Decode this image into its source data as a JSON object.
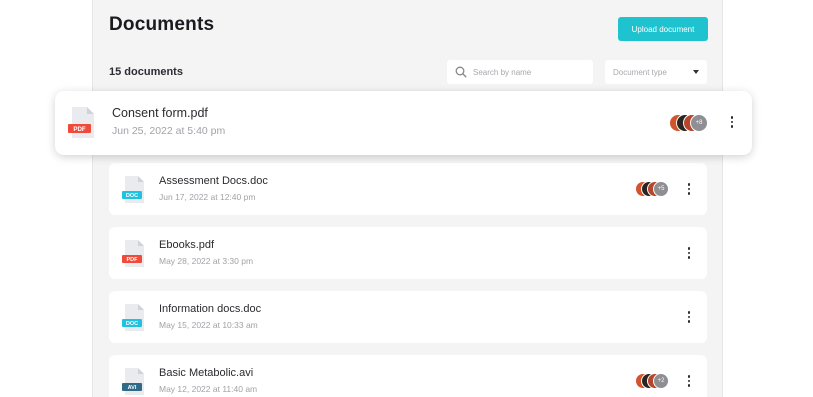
{
  "page": {
    "title": "Documents",
    "upload_label": "Upload document",
    "count_label": "15 documents",
    "search_placeholder": "Search by name",
    "type_filter_label": "Document type"
  },
  "colors": {
    "accent": "#1fc3cf",
    "pdf": "#f04b3a",
    "doc": "#1fc3e0",
    "avi": "#2f6b88"
  },
  "documents": [
    {
      "name": "Consent form.pdf",
      "date": "Jun 25, 2022 at 5:40 pm",
      "type": "PDF",
      "extra_count": "+8"
    },
    {
      "name": "Assessment Docs.doc",
      "date": "Jun 17, 2022 at 12:40 pm",
      "type": "DOC",
      "extra_count": "+5"
    },
    {
      "name": "Ebooks.pdf",
      "date": "May 28, 2022 at 3:30 pm",
      "type": "PDF",
      "extra_count": ""
    },
    {
      "name": "Information docs.doc",
      "date": "May 15, 2022 at 10:33 am",
      "type": "DOC",
      "extra_count": ""
    },
    {
      "name": "Basic Metabolic.avi",
      "date": "May 12, 2022 at 11:40 am",
      "type": "AVI",
      "extra_count": "+2"
    }
  ]
}
